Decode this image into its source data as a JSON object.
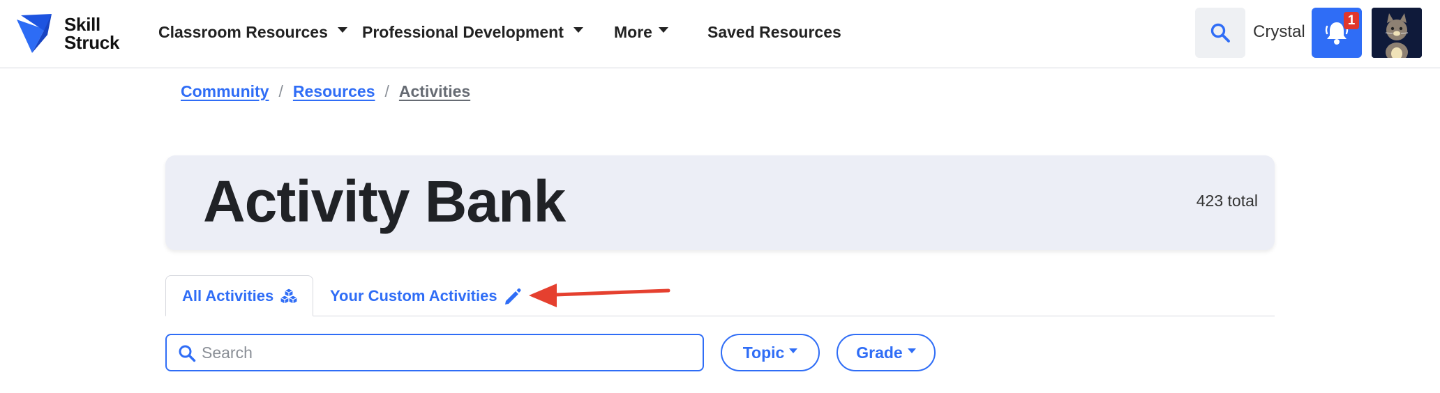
{
  "brand": {
    "name_line1": "Skill",
    "name_line2": "Struck",
    "accent_color": "#2f6df6"
  },
  "nav": {
    "items": [
      {
        "label": "Classroom Resources",
        "has_dropdown": true
      },
      {
        "label": "Professional Development",
        "has_dropdown": true
      },
      {
        "label": "More",
        "has_dropdown": true
      },
      {
        "label": "Saved Resources",
        "has_dropdown": false
      }
    ],
    "search_icon": "search-icon",
    "user_name": "Crystal",
    "notifications": {
      "icon": "bell-icon",
      "count": "1",
      "badge_color": "#e0362c"
    },
    "avatar_icon": "cat-avatar"
  },
  "breadcrumb": {
    "items": [
      {
        "label": "Community"
      },
      {
        "label": "Resources"
      },
      {
        "label": "Activities"
      }
    ],
    "separator": "/"
  },
  "header": {
    "title": "Activity Bank",
    "total": "423 total"
  },
  "tabs": [
    {
      "label": "All Activities",
      "icon": "cubes-icon",
      "active": true
    },
    {
      "label": "Your Custom Activities",
      "icon": "pencil-icon",
      "active": false
    }
  ],
  "annotation": {
    "type": "arrow",
    "color": "#e5402f",
    "points_to": "Your Custom Activities"
  },
  "filters": {
    "search_placeholder": "Search",
    "search_value": "",
    "topic_label": "Topic",
    "grade_label": "Grade"
  }
}
